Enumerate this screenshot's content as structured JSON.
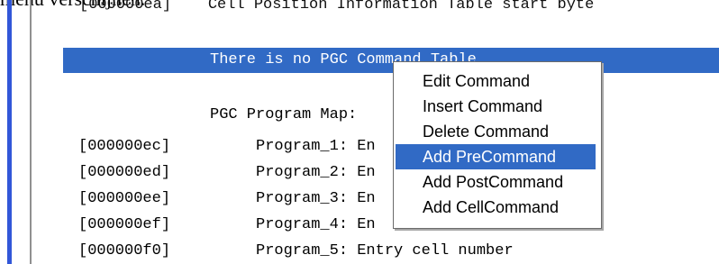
{
  "caption_fragment": "menu verschijnen.",
  "editor": {
    "top_fragment": "[000000ea]    Cell Position Information Table start byte",
    "selected_line": "There is no PGC Command Table",
    "program_map_title": "PGC Program Map:",
    "rows": [
      {
        "address": "[000000ec]",
        "program": "Program_1: En"
      },
      {
        "address": "[000000ed]",
        "program": "Program_2: En"
      },
      {
        "address": "[000000ee]",
        "program": "Program_3: En"
      },
      {
        "address": "[000000ef]",
        "program": "Program_4: En"
      },
      {
        "address": "[000000f0]",
        "program": "Program_5: Entry cell number"
      }
    ]
  },
  "context_menu": {
    "items": [
      {
        "label": "Edit Command",
        "active": false
      },
      {
        "label": "Insert Command",
        "active": false
      },
      {
        "label": "Delete Command",
        "active": false
      },
      {
        "label": "Add PreCommand",
        "active": true
      },
      {
        "label": "Add PostCommand",
        "active": false
      },
      {
        "label": "Add CellCommand",
        "active": false
      }
    ]
  },
  "colors": {
    "selection": "#316ac5",
    "left_accent": "#3257d8",
    "menu_border": "#6b6b6b"
  }
}
